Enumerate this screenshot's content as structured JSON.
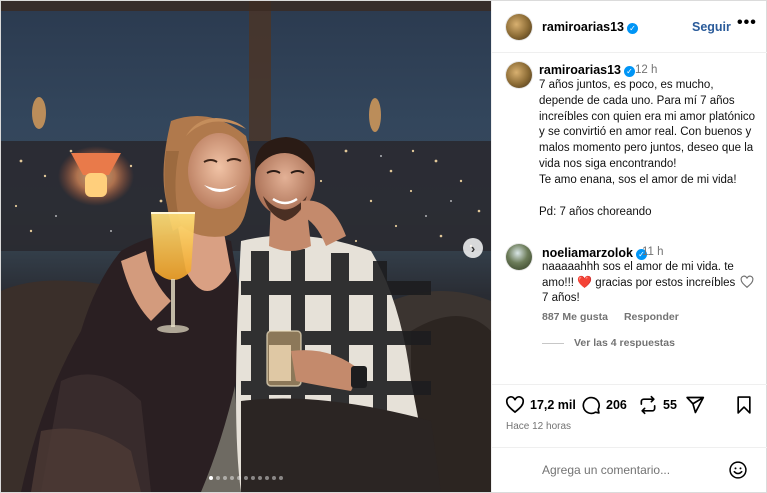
{
  "photo": {
    "alt_icon": "photo-carousel",
    "next_icon": "chevron-right-icon",
    "next_glyph": "›",
    "dots_count": 11,
    "active_dot": 0
  },
  "header": {
    "username": "ramiroarias13",
    "verified_glyph": "✓",
    "follow_label": "Seguir",
    "more_label": "•••"
  },
  "caption": {
    "username": "ramiroarias13",
    "time": "12 h",
    "text_main": "7 años juntos, es poco, es mucho, depende de cada uno. Para mí 7 años increíbles con quien era mi amor platónico y se convirtió en amor real. Con buenos y malos momento pero juntos, deseo que la vida nos siga encontrando!\nTe amo enana, sos el amor de mi vida!",
    "text_ps": "Pd: 7 años choreando"
  },
  "comment": {
    "username": "noeliamarzolok",
    "time": "11 h",
    "text_before": "naaaaahhh sos el amor de mi vida. te amo!!! ",
    "heart": "❤️",
    "text_after": " gracias por estos increíbles 7 años!",
    "likes": "887 Me gusta",
    "reply_label": "Responder",
    "view_replies": "Ver las 4 respuestas"
  },
  "actions": {
    "likes": "17,2 mil",
    "comments": "206",
    "reposts": "55",
    "time_ago": "Hace 12 horas"
  },
  "add_comment": {
    "placeholder": "Agrega un comentario..."
  }
}
